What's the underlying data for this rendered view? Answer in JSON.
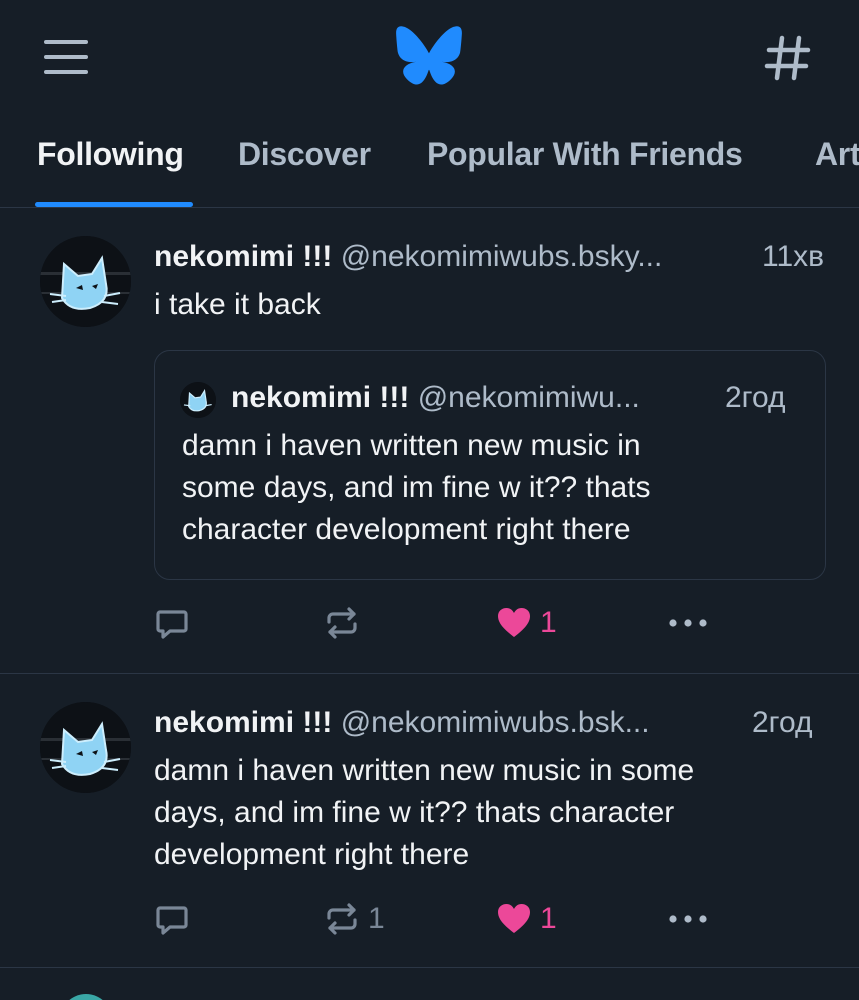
{
  "header": {
    "menu_icon": "hamburger-menu-icon",
    "logo_icon": "bluesky-butterfly-icon",
    "feeds_icon": "hashtag-icon",
    "accent_color": "#208bfe"
  },
  "tabs": [
    {
      "label": "Following",
      "active": true
    },
    {
      "label": "Discover",
      "active": false
    },
    {
      "label": "Popular With Friends",
      "active": false
    },
    {
      "label": "Art",
      "active": false
    }
  ],
  "posts": [
    {
      "author_name": "nekomimi !!!",
      "handle": "@nekomimiwubs.bsky...",
      "time": "11хв",
      "text": "i take it back",
      "quote": {
        "author_name": "nekomimi !!!",
        "handle": "@nekomimiwu...",
        "time": "2год",
        "text": "damn i haven written new music in\nsome days, and im fine w it?? thats\ncharacter development right there"
      },
      "replies": "",
      "reposts": "",
      "likes": "1",
      "liked": true
    },
    {
      "author_name": "nekomimi !!!",
      "handle": "@nekomimiwubs.bsk...",
      "time": "2год",
      "text": "damn i haven written new music in some\ndays, and im fine w it?? thats character\ndevelopment right there",
      "replies": "",
      "reposts": "1",
      "likes": "1",
      "liked": true
    }
  ],
  "colors": {
    "background": "#161e27",
    "like": "#ec4899",
    "muted": "#aebbc9"
  }
}
